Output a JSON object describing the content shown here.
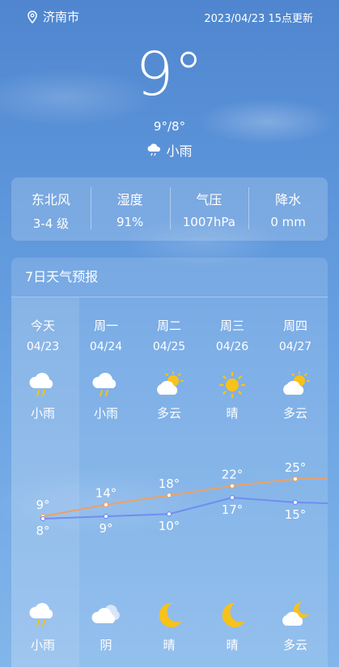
{
  "header": {
    "city": "济南市",
    "updated": "2023/04/23 15点更新"
  },
  "current": {
    "temp": "9°",
    "range": "9°/8°",
    "condition": "小雨"
  },
  "stats": [
    {
      "label": "东北风",
      "value": "3-4 级"
    },
    {
      "label": "湿度",
      "value": "91%"
    },
    {
      "label": "气压",
      "value": "1007hPa"
    },
    {
      "label": "降水",
      "value": "0 mm"
    }
  ],
  "forecast": {
    "title": "7日天气预报",
    "days": [
      {
        "name": "今天",
        "date": "04/23",
        "day_icon": "rain-icon",
        "day_text": "小雨",
        "high": 9,
        "low": 8,
        "night_icon": "rain-icon",
        "night_text": "小雨"
      },
      {
        "name": "周一",
        "date": "04/24",
        "day_icon": "rain-icon",
        "day_text": "小雨",
        "high": 14,
        "low": 9,
        "night_icon": "cloudy-icon",
        "night_text": "阴"
      },
      {
        "name": "周二",
        "date": "04/25",
        "day_icon": "partly-cloudy-icon",
        "day_text": "多云",
        "high": 18,
        "low": 10,
        "night_icon": "moon-icon",
        "night_text": "晴"
      },
      {
        "name": "周三",
        "date": "04/26",
        "day_icon": "sun-icon",
        "day_text": "晴",
        "high": 22,
        "low": 17,
        "night_icon": "moon-icon",
        "night_text": "晴"
      },
      {
        "name": "周四",
        "date": "04/27",
        "day_icon": "partly-cloudy-icon",
        "day_text": "多云",
        "high": 25,
        "low": 15,
        "night_icon": "moon-cloud-icon",
        "night_text": "多云"
      }
    ],
    "high_labels": [
      "9°",
      "14°",
      "18°",
      "22°",
      "25°"
    ],
    "low_labels": [
      "8°",
      "9°",
      "10°",
      "17°",
      "15°"
    ]
  },
  "colors": {
    "high_line": "#f0a060",
    "low_line": "#6f8ef0",
    "sun": "#f7c21a"
  }
}
